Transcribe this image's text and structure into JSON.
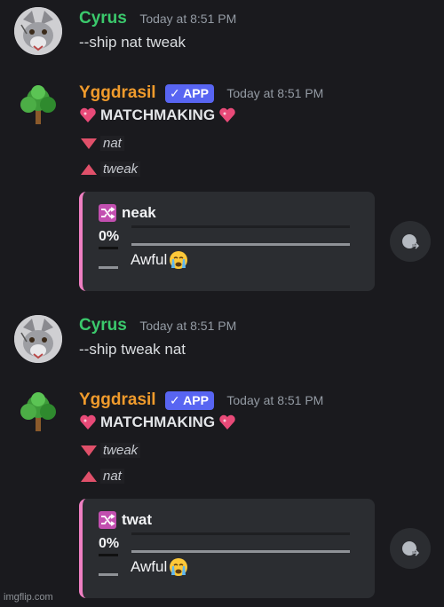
{
  "messages": [
    {
      "author": "Cyrus",
      "timestamp": "Today at 8:51 PM",
      "text": "--ship nat tweak"
    },
    {
      "author": "Yggdrasil",
      "badge": "✓ APP",
      "timestamp": "Today at 8:51 PM",
      "heading": "MATCHMAKING",
      "down_name": "nat",
      "up_name": "tweak",
      "embed": {
        "ship_name": "neak",
        "percent_text": "0%",
        "percent_value": 0,
        "verdict": "Awful"
      }
    },
    {
      "author": "Cyrus",
      "timestamp": "Today at 8:51 PM",
      "text": "--ship tweak nat"
    },
    {
      "author": "Yggdrasil",
      "badge": "✓ APP",
      "timestamp": "Today at 8:51 PM",
      "heading": "MATCHMAKING",
      "down_name": "tweak",
      "up_name": "nat",
      "embed": {
        "ship_name": "twat",
        "percent_text": "0%",
        "percent_value": 0,
        "verdict": "Awful"
      }
    }
  ],
  "colors": {
    "cyrus_name": "#3bc96c",
    "yggdrasil_name": "#f09b2c",
    "app_badge": "#5865f2",
    "embed_accent": "#ef7fc2",
    "arrow": "#e0506a"
  },
  "icons": {
    "heart": "sparkling-heart-icon",
    "down": "down-triangle-icon",
    "up": "up-triangle-icon",
    "shuffle": "shuffle-icon",
    "cry": "crying-face-icon",
    "react": "add-reaction-icon"
  },
  "watermark": "imgflip.com"
}
